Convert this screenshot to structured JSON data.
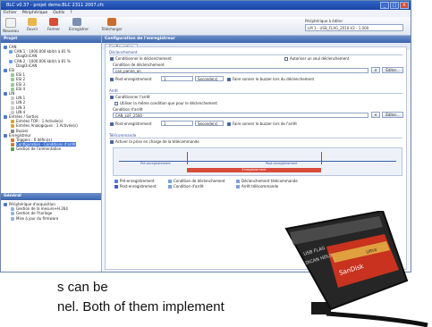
{
  "window": {
    "title": "BLC v0.37 - projet demo.BLC 2311 2007.cfc",
    "controls": [
      "_",
      "□",
      "×"
    ]
  },
  "menu": [
    "Fichier",
    "Périphérique",
    "Outils",
    "?"
  ],
  "toolbar": {
    "tools": [
      "Nouveau",
      "Ouvrir",
      "Fermer",
      "Enregistrer",
      "Télécharger"
    ],
    "peripheral_label": "Périphérique à éditer",
    "peripheral_value": "LM 1 - USB_FLAG_2010-V2 - 1.000"
  },
  "left_panel": {
    "header": "Projet",
    "tree": [
      "CAN",
      "CAN 1 : 1000.000 kbit/s à 81 %",
      "DiagOnCAN",
      "CAN 2 : 1000.000 kbit/s à 81 %",
      "DiagOnCAN",
      "ESI",
      "ESI 1",
      "ESI 2",
      "ESI 3",
      "ESI 4",
      "LIN",
      "LIN 1",
      "LIN 2",
      "LIN 3",
      "LIN 4",
      "Entrées / Sorties",
      "Entrées TOR : 1 Activée(s)",
      "Entrées Analogiques : 1 Activée(s)",
      "Buzzer",
      "Enregistreur",
      "Triggers : 6 défini(s)",
      "Configuration - Conditions d'arrêt",
      "Gestion de l'alimentation"
    ],
    "general_header": "Général",
    "general_items": [
      "Périphérique d'acquisition",
      "Gestion de la mesure+H.264",
      "Gestion de l'horloge",
      "Mise à jour du firmware"
    ]
  },
  "right_panel": {
    "header": "Configuration de l'enregistreur",
    "tab": "Configuration",
    "start": {
      "section": "Déclenchement",
      "checkbox_condition": "Conditionner le déclenchement",
      "checkbox_auto": "Autoriser un seul déclenchement",
      "condition_label": "Condition de déclenchement",
      "condition_value": "can_panne_on",
      "edit_button": "Éditer...",
      "pre_label": "Post-enregistrement",
      "pre_value": "1",
      "unit": "Seconde(s)",
      "buzzer_label": "Faire sonner le buzzer lors du déclenchement"
    },
    "stop": {
      "section": "Arrêt",
      "checkbox_condition": "Conditionner l'arrêt",
      "checkbox_single": "Utiliser la même condition que pour le déclenchement",
      "condition_label": "Condition d'arrêt",
      "condition_value": "CAN_LUF_2500",
      "edit_button": "Éditer...",
      "post_label": "Post-enregistrement",
      "post_value": "1",
      "unit": "Seconde(s)",
      "buzzer_label": "Faire sonner le buzzer lors de l'arrêt"
    },
    "remote": {
      "section": "Télécommande",
      "checkbox": "Activer la prise en charge de la télécommande"
    },
    "timeline": {
      "segment_pre": "Pré-enregistrement",
      "segment_post": "Post-enregistrement",
      "segment_record": "Enregistrement"
    },
    "legend": [
      {
        "label": "Pré-enregistrement",
        "color": "#5c7fd6"
      },
      {
        "label": "Post-enregistrement",
        "color": "#3f5fb8"
      },
      {
        "label": "Condition de déclenchement",
        "color": "#7aa2e0"
      },
      {
        "label": "Condition d'arrêt",
        "color": "#7aa2e0"
      },
      {
        "label": "Déclenchement télécommande",
        "color": "#7aa2e0"
      },
      {
        "label": "Arrêt télécommande",
        "color": "#7aa2e0"
      }
    ]
  },
  "caption": {
    "line1": "s can be",
    "line2": "nel. Both of them implement"
  },
  "device": {
    "label1": "SanDisk",
    "label2": "Ultra",
    "label3": "USB FLAG",
    "label4": "DiCAN HDLS"
  }
}
